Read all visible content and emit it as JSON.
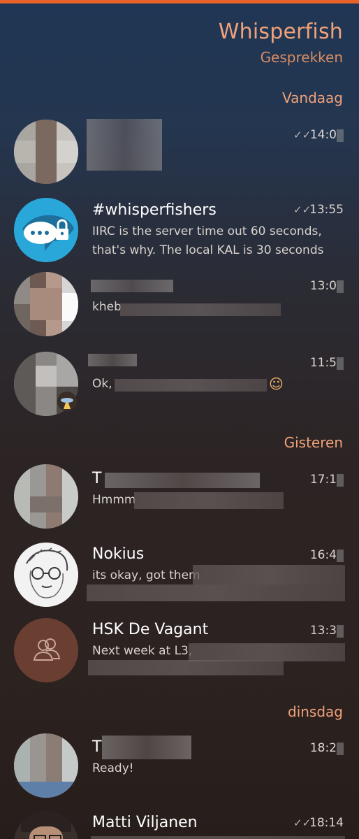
{
  "app": {
    "title": "Whisperfish",
    "subtitle": "Gesprekken"
  },
  "sections": {
    "today": "Vandaag",
    "yesterday": "Gisteren",
    "tuesday": "dinsdag"
  },
  "conversations": [
    {
      "name": "",
      "message": "",
      "time": "14:0",
      "read_ticks": "✓✓"
    },
    {
      "name": "#whisperfishers",
      "message": "IIRC is the server time out 60 seconds, that's why. The local KAL is 30 seconds",
      "time": "13:55",
      "read_ticks": "✓✓"
    },
    {
      "name": "",
      "message": "kheb",
      "time": "13:0"
    },
    {
      "name": "",
      "message": "Ok,",
      "time": "11:5",
      "emoji": "☺"
    },
    {
      "name": "T",
      "message": "Hmmm",
      "time": "17:1"
    },
    {
      "name": "Nokius",
      "message": "its okay, got them",
      "time": "16:4"
    },
    {
      "name": "HSK De Vagant",
      "message": "Next week at L3,",
      "time": "13:3"
    },
    {
      "name": "T",
      "message": "Ready!",
      "time": "18:2"
    },
    {
      "name": "Matti Viljanen",
      "message": "",
      "time": "18:14",
      "read_ticks": "✓✓"
    }
  ],
  "colors": {
    "accent": "#e8632a",
    "highlight": "#f0a27a"
  },
  "icons": {
    "group": "people-icon",
    "read": "double-check-icon"
  }
}
